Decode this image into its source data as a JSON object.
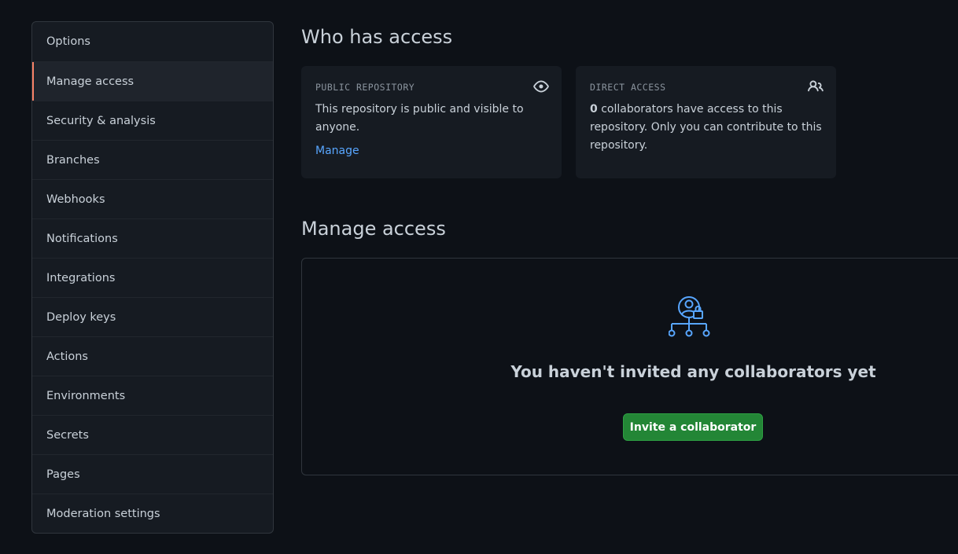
{
  "sidebar": {
    "items": [
      {
        "label": "Options",
        "selected": false
      },
      {
        "label": "Manage access",
        "selected": true
      },
      {
        "label": "Security & analysis",
        "selected": false
      },
      {
        "label": "Branches",
        "selected": false
      },
      {
        "label": "Webhooks",
        "selected": false
      },
      {
        "label": "Notifications",
        "selected": false
      },
      {
        "label": "Integrations",
        "selected": false
      },
      {
        "label": "Deploy keys",
        "selected": false
      },
      {
        "label": "Actions",
        "selected": false
      },
      {
        "label": "Environments",
        "selected": false
      },
      {
        "label": "Secrets",
        "selected": false
      },
      {
        "label": "Pages",
        "selected": false
      },
      {
        "label": "Moderation settings",
        "selected": false
      }
    ],
    "selected_accent": "#f78166"
  },
  "who_has_access": {
    "title": "Who has access",
    "public_card": {
      "label": "PUBLIC REPOSITORY",
      "text": "This repository is public and visible to anyone.",
      "link": "Manage",
      "icon": "eye-icon"
    },
    "direct_card": {
      "label": "DIRECT ACCESS",
      "count": "0",
      "text": " collaborators have access to this repository. Only you can contribute to this repository.",
      "icon": "people-icon"
    }
  },
  "manage_access": {
    "title": "Manage access",
    "empty_icon": "person-lock-icon",
    "empty_title": "You haven't invited any collaborators yet",
    "invite_label": "Invite a collaborator"
  },
  "colors": {
    "background": "#0d1117",
    "panel": "#161b22",
    "border": "#30363d",
    "link": "#58a6ff",
    "primary_button": "#238636",
    "icon_accent": "#58a6ff"
  }
}
